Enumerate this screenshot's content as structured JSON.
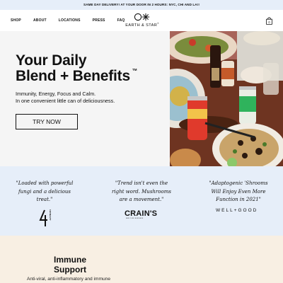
{
  "promo": {
    "text": "SAME DAY DELIVERY! AT YOUR DOOR IN 2 HOURS: NYC, CHI AND LA!!"
  },
  "nav": {
    "links": [
      "SHOP",
      "ABOUT",
      "LOCATIONS",
      "PRESS",
      "FAQ"
    ],
    "logo_text": "EARTH & STAR",
    "logo_trademark": "®",
    "cart_icon": "shopping-bag-icon",
    "cart_count": "0"
  },
  "hero": {
    "headline_line1": "Your Daily",
    "headline_line2": "Blend + Benefits",
    "trademark": "TM",
    "subtitle_line1": "Immunity, Energy, Focus and Calm.",
    "subtitle_line2": "In one convenient little can of deliciousness.",
    "cta_label": "TRY NOW"
  },
  "press": {
    "quotes": [
      {
        "line1": "\"Loaded with powerful",
        "line2": "fungi and a delicious",
        "line3": "treat.\""
      },
      {
        "line1": "\"Trend isn't even the",
        "line2": "right word. Mushrooms",
        "line3": "are a movement.\""
      },
      {
        "line1": "\"Adaptogenic 'Shrooms",
        "line2": "Will Enjoy Even More",
        "line3": "Function in 2021\""
      }
    ],
    "outlets": {
      "crains": "CRAIN'S",
      "crains_sub": "NEW YORK BUSINESS",
      "wellgood": "WELL+GOOD",
      "cap_beauty": "CAP BEAUTY"
    }
  },
  "benefits": {
    "title_line1": "Immune",
    "title_line2": "Support",
    "description": "Anti-viral, anti-inflammatory and immune"
  },
  "colors": {
    "promo_bg": "#e6eef9",
    "hero_bg": "#f5f5f5",
    "press_bg": "#e6eef9",
    "benefits_bg": "#f8efe3",
    "text": "#111111"
  }
}
